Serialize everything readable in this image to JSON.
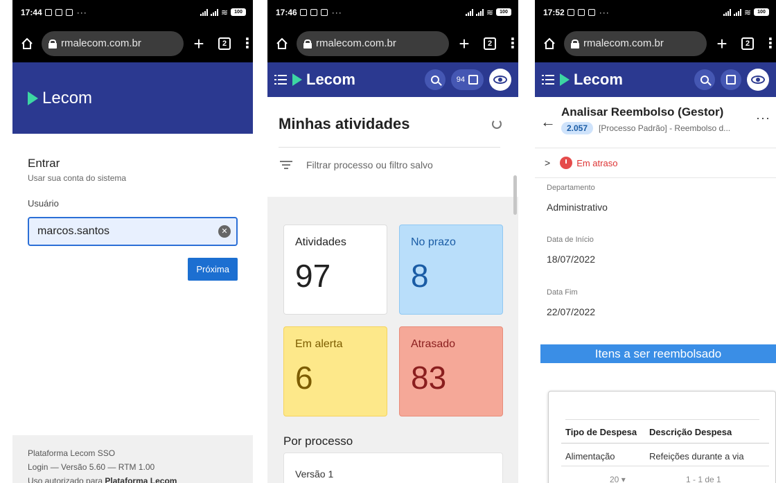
{
  "phones": [
    {
      "status": {
        "time": "17:44"
      },
      "browser": {
        "url": "rmalecom.com.br",
        "tab_count": "2"
      },
      "logo": "Lecom",
      "login": {
        "title": "Entrar",
        "subtitle": "Usar sua conta do sistema",
        "user_label": "Usuário",
        "user_value": "marcos.santos",
        "next_button": "Próxima"
      },
      "footer": {
        "line1": "Plataforma Lecom SSO",
        "line2": "Login — Versão 5.60 — RTM 1.00",
        "line3_prefix": "Uso autorizado para ",
        "line3_bold": "Plataforma Lecom"
      }
    },
    {
      "status": {
        "time": "17:46"
      },
      "browser": {
        "url": "rmalecom.com.br",
        "tab_count": "2"
      },
      "logo": "Lecom",
      "tasks_count": "94",
      "page_title": "Minhas atividades",
      "filter_placeholder": "Filtrar processo ou filtro salvo",
      "cards": [
        {
          "label": "Atividades",
          "value": "97"
        },
        {
          "label": "No prazo",
          "value": "8"
        },
        {
          "label": "Em alerta",
          "value": "6"
        },
        {
          "label": "Atrasado",
          "value": "83"
        }
      ],
      "section_title": "Por processo",
      "process_item": "Versão 1"
    },
    {
      "status": {
        "time": "17:52"
      },
      "browser": {
        "url": "rmalecom.com.br",
        "tab_count": "2"
      },
      "logo": "Lecom",
      "task": {
        "title": "Analisar Reembolso (Gestor)",
        "id": "2.057",
        "process": "[Processo Padrão] - Reembolso d..."
      },
      "status_text": "Em atraso",
      "fields": [
        {
          "label": "Departamento",
          "value": "Administrativo"
        },
        {
          "label": "Data de Início",
          "value": "18/07/2022"
        },
        {
          "label": "Data Fim",
          "value": "22/07/2022"
        }
      ],
      "section_band": "Itens a ser reembolsado",
      "table": {
        "headers": [
          "Tipo de Despesa",
          "Descrição Despesa"
        ],
        "row": [
          "Alimentação",
          "Refeições durante a via"
        ],
        "page_size": "20",
        "range": "1 - 1 de 1"
      }
    }
  ],
  "colors": {
    "brand": "#2b3990",
    "accent": "#3dd6a3",
    "primary_button": "#1c6fd1"
  }
}
